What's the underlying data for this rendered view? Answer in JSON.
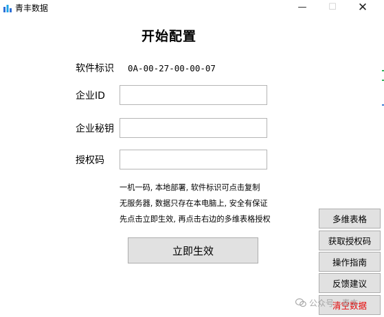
{
  "window": {
    "title": "青丰数据",
    "minimize_glyph": "—",
    "maximize_glyph": "☐",
    "close_glyph": "✕"
  },
  "main": {
    "title": "开始配置",
    "software_id_label": "软件标识",
    "software_id_value": "0A-00-27-00-00-07",
    "company_id_label": "企业ID",
    "company_id_value": "",
    "company_key_label": "企业秘钥",
    "company_key_value": "",
    "auth_code_label": "授权码",
    "auth_code_value": "",
    "info_lines": [
      "一机一码, 本地部署, 软件标识可点击复制",
      "无服务器, 数据只存在本电脑上, 安全有保证",
      "先点击立即生效, 再点击右边的多维表格授权"
    ],
    "activate_label": "立即生效"
  },
  "side": {
    "buttons": [
      "多维表格",
      "获取授权码",
      "操作指南",
      "反馈建议",
      "清空数据"
    ]
  },
  "watermark": {
    "text": "公众号 · 青丰"
  },
  "colors": {
    "danger_text": "#e60000",
    "button_bg": "#e1e1e1",
    "edge_green": "#2eb35a",
    "edge_blue": "#3a7bd5"
  }
}
